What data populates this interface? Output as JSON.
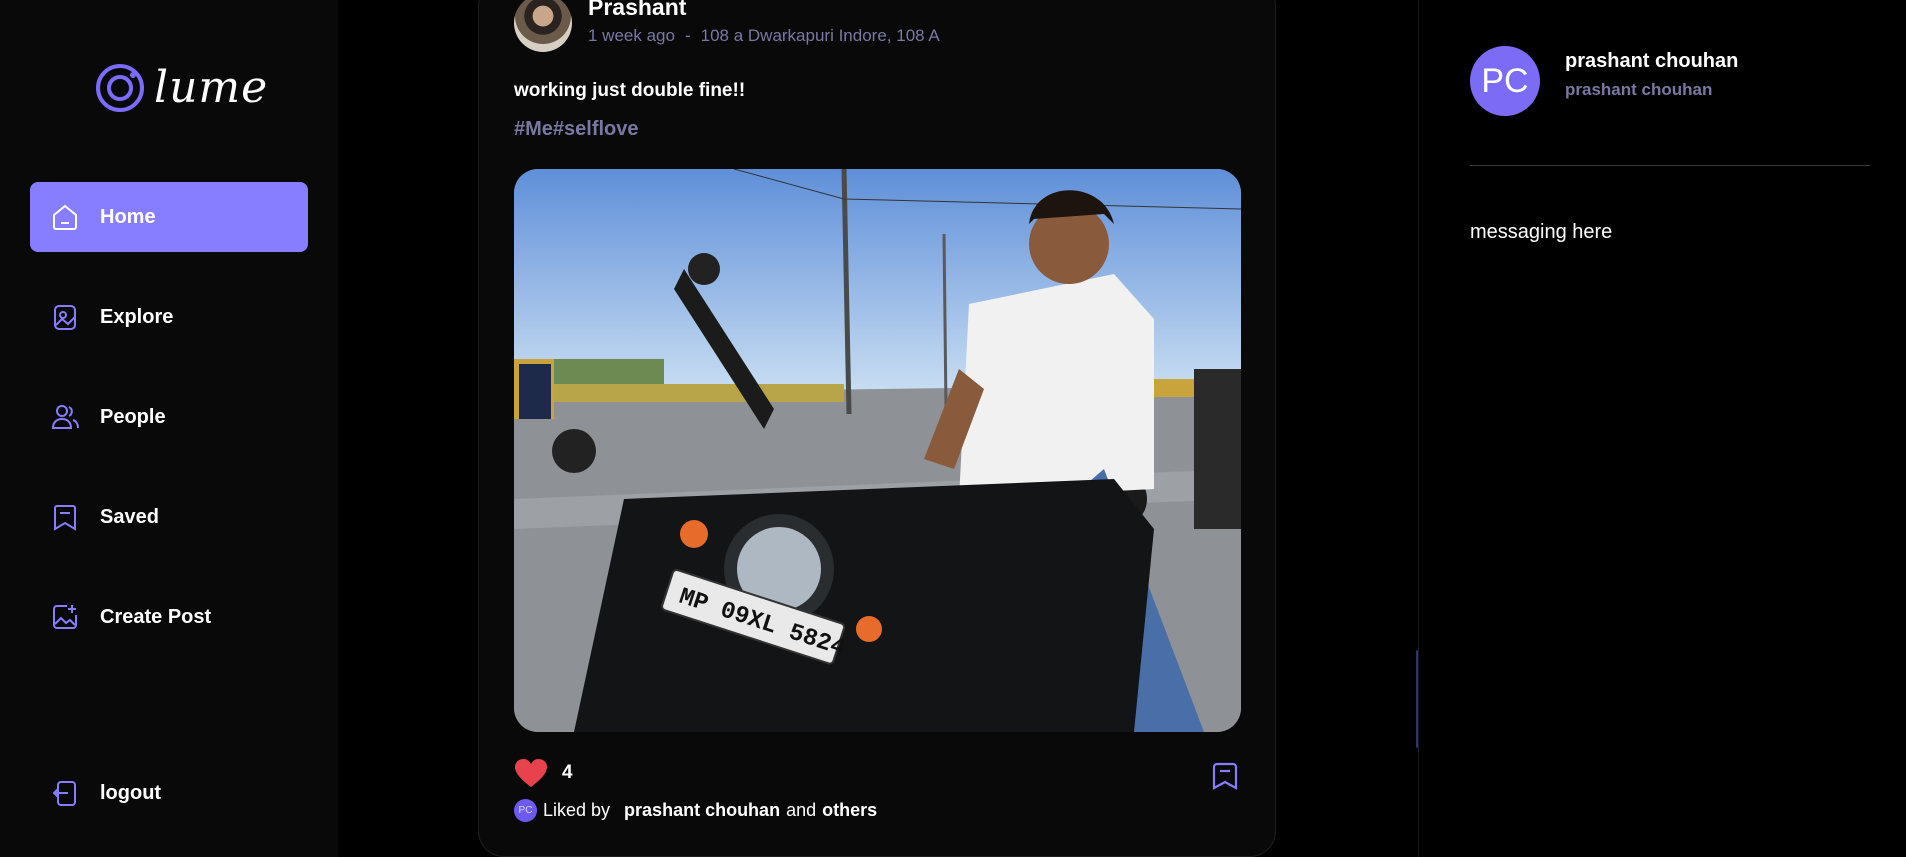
{
  "app": {
    "name": "lume"
  },
  "sidebar": {
    "items": [
      {
        "label": "Home",
        "icon": "home-icon",
        "active": true
      },
      {
        "label": "Explore",
        "icon": "explore-icon"
      },
      {
        "label": "People",
        "icon": "people-icon"
      },
      {
        "label": "Saved",
        "icon": "bookmark-icon"
      },
      {
        "label": "Create Post",
        "icon": "create-post-icon"
      }
    ],
    "logout_label": "logout"
  },
  "post": {
    "author": "Prashant",
    "time": "1 week ago",
    "separator": "-",
    "location": "108 a Dwarkapuri Indore, 108 A",
    "caption": "working just double fine!!",
    "tags": "#Me#selflove",
    "like_count": "4",
    "liked_by_prefix": "Liked by",
    "liked_by_name": "prashant chouhan",
    "liked_by_and": "and",
    "liked_by_others": "others",
    "mini_avatar_initials": "PC"
  },
  "profile": {
    "initials": "PC",
    "name": "prashant chouhan",
    "username": "prashant chouhan"
  },
  "messaging": {
    "text": "messaging here"
  },
  "colors": {
    "accent": "#877eff",
    "muted": "#7878a3",
    "like": "#e8424f"
  }
}
